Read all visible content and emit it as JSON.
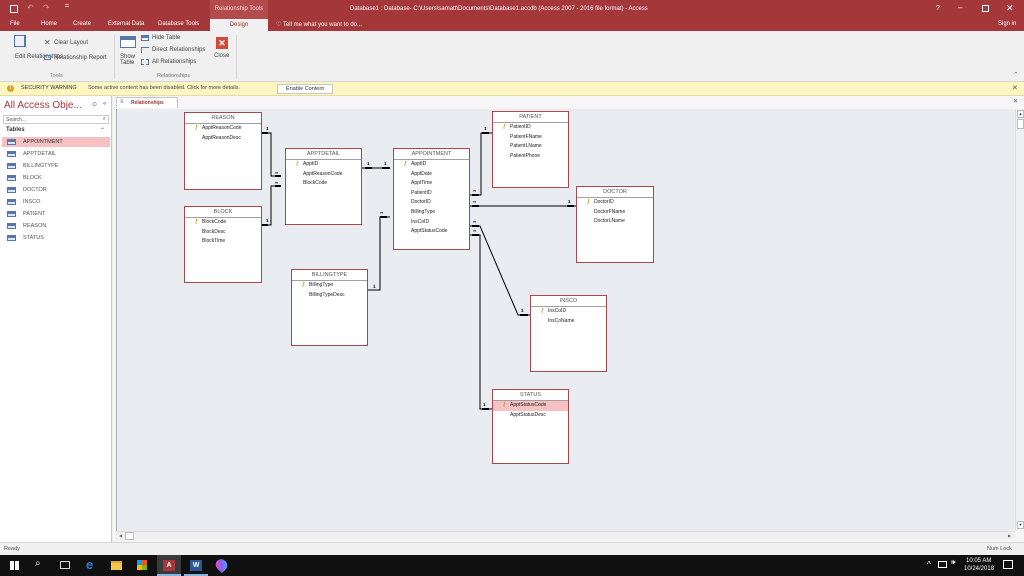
{
  "titlebar": {
    "qat_icons": [
      "save-icon",
      "undo-icon",
      "redo-icon",
      "customize-icon"
    ],
    "context_label": "Relationship Tools",
    "window_title": "Database1 : Database- C:\\Users\\samatt\\Documents\\Database1.accdb (Access 2007 - 2016 file format) - Access",
    "help": "?",
    "sign_in": "Sign in"
  },
  "tabs": [
    "File",
    "Home",
    "Create",
    "External Data",
    "Database Tools",
    "Design"
  ],
  "active_tab": "Design",
  "tell_me": "Tell me what you want to do...",
  "ribbon": {
    "tools": {
      "edit_relationships": "Edit Relationships",
      "clear_layout": "Clear Layout",
      "relationship_report": "Relationship Report",
      "group": "Tools"
    },
    "relationships": {
      "show_table": "Show Table",
      "hide_table": "Hide Table",
      "direct_relationships": "Direct Relationships",
      "all_relationships": "All Relationships",
      "close": "Close",
      "group": "Relationships"
    }
  },
  "security": {
    "label": "SECURITY WARNING",
    "message": "Some active content has been disabled. Click for more details.",
    "button": "Enable Content"
  },
  "nav": {
    "title": "All Access Obje...",
    "search_placeholder": "Search...",
    "section": "Tables",
    "items": [
      {
        "label": "APPOINTMENT",
        "selected": true
      },
      {
        "label": "APPTDETAIL",
        "selected": false
      },
      {
        "label": "BILLINGTYPE",
        "selected": false
      },
      {
        "label": "BLOCK",
        "selected": false
      },
      {
        "label": "DOCTOR",
        "selected": false
      },
      {
        "label": "INSCO",
        "selected": false
      },
      {
        "label": "PATIENT",
        "selected": false
      },
      {
        "label": "REASON",
        "selected": false
      },
      {
        "label": "STATUS",
        "selected": false
      }
    ]
  },
  "doc_tab": "Relationships",
  "tables": {
    "reason": {
      "title": "REASON",
      "fields": [
        "ApptReasonCode",
        "ApptReasonDesc"
      ]
    },
    "block": {
      "title": "BLOCK",
      "fields": [
        "BlockCode",
        "BlockDesc",
        "BlockTime"
      ]
    },
    "apptdetail": {
      "title": "APPTDETAIL",
      "fields": [
        "ApptID",
        "ApptReasonCode",
        "BlockCode"
      ]
    },
    "appointment": {
      "title": "APPOINTMENT",
      "fields": [
        "ApptID",
        "ApptDate",
        "ApptTime",
        "PatientID",
        "DoctorID",
        "BillingType",
        "InsCoID",
        "ApptStatusCode"
      ]
    },
    "patient": {
      "title": "PATIENT",
      "fields": [
        "PatientID",
        "PatientFName",
        "PatientLName",
        "PatientPhone"
      ]
    },
    "doctor": {
      "title": "DOCTOR",
      "fields": [
        "DoctorID",
        "DoctorFName",
        "DoctorLName"
      ]
    },
    "billingtype": {
      "title": "BILLINGTYPE",
      "fields": [
        "BillingType",
        "BillingTypeDesc"
      ]
    },
    "insco": {
      "title": "INSCO",
      "fields": [
        "InsCoID",
        "InsCoName"
      ]
    },
    "status": {
      "title": "STATUS",
      "fields": [
        "ApptStatusCode",
        "ApptStatusDesc"
      ]
    }
  },
  "cardinality": {
    "one": "1",
    "many": "∞"
  },
  "status": {
    "left": "Ready",
    "right": "Num Lock"
  },
  "taskbar": {
    "time": "10:05 AM",
    "date": "10/24/2018",
    "apps": [
      "start-icon",
      "search-icon",
      "task-view-icon",
      "edge-icon",
      "file-explorer-icon",
      "store-icon",
      "access-icon",
      "word-icon",
      "paint3d-icon"
    ]
  }
}
